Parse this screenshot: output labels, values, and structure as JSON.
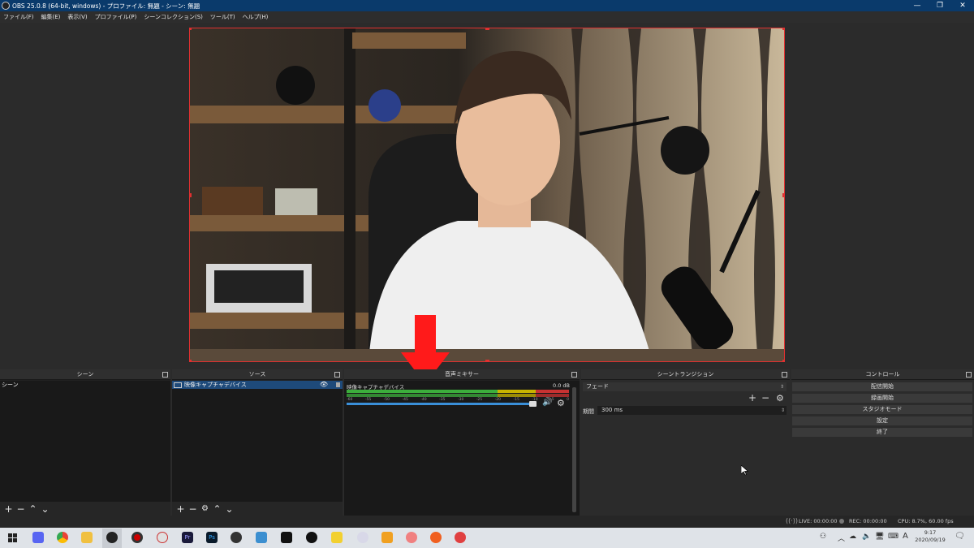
{
  "window": {
    "title": "OBS 25.0.8 (64-bit, windows) - プロファイル: 無題 - シーン: 無題"
  },
  "menu": [
    "ファイル(F)",
    "編集(E)",
    "表示(V)",
    "プロファイル(P)",
    "シーンコレクション(S)",
    "ツール(T)",
    "ヘルプ(H)"
  ],
  "docks": {
    "scenes": {
      "title": "シーン",
      "items": [
        "シーン"
      ]
    },
    "sources": {
      "title": "ソース",
      "items": [
        "映像キャプチャデバイス"
      ]
    },
    "mixer": {
      "title": "音声ミキサー",
      "channel_name": "映像キャプチャデバイス",
      "level": "0.0 dB",
      "scale": [
        "-60",
        "-55",
        "-50",
        "-45",
        "-40",
        "-35",
        "-30",
        "-25",
        "-20",
        "-15",
        "-10",
        "-5",
        "0"
      ]
    },
    "transitions": {
      "title": "シーントランジション",
      "selected": "フェード",
      "duration_label": "期間",
      "duration_value": "300 ms"
    },
    "controls": {
      "title": "コントロール",
      "buttons": [
        "配信開始",
        "録画開始",
        "スタジオモード",
        "設定",
        "終了"
      ]
    }
  },
  "status": {
    "live": "LIVE: 00:00:00",
    "rec": "REC: 00:00:00",
    "cpu": "CPU: 8.7%, 60.00 fps"
  },
  "taskbar": {
    "time": "9:17",
    "date": "2020/09/19",
    "ime": "A"
  },
  "colors": {
    "selection": "#e03030",
    "accent": "#1e4a7a",
    "meter_green": "#3cae3c",
    "meter_yellow": "#c8b400",
    "meter_red": "#c83232"
  }
}
